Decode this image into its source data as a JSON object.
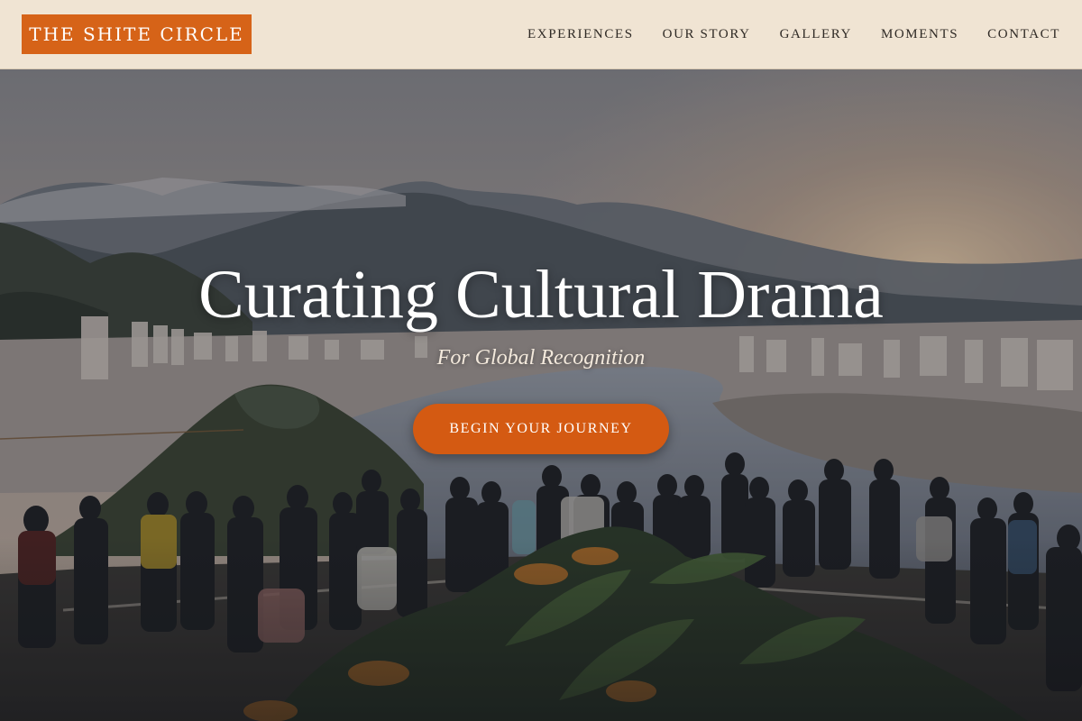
{
  "brand": {
    "name": "THE SHITE CIRCLE",
    "color": "#d66318"
  },
  "nav": {
    "items": [
      {
        "label": "EXPERIENCES"
      },
      {
        "label": "OUR STORY"
      },
      {
        "label": "GALLERY"
      },
      {
        "label": "MOMENTS"
      },
      {
        "label": "CONTACT"
      }
    ]
  },
  "hero": {
    "title": "Curating Cultural Drama",
    "subtitle": "For Global Recognition",
    "cta_label": "BEGIN YOUR JOURNEY",
    "image_alt": "Crowd of people at a scenic overlook above a coastal city and bay with mountains at sunset"
  },
  "colors": {
    "header_bg": "#f0e4d3",
    "accent": "#d45a12",
    "nav_text": "#2f2a25"
  }
}
